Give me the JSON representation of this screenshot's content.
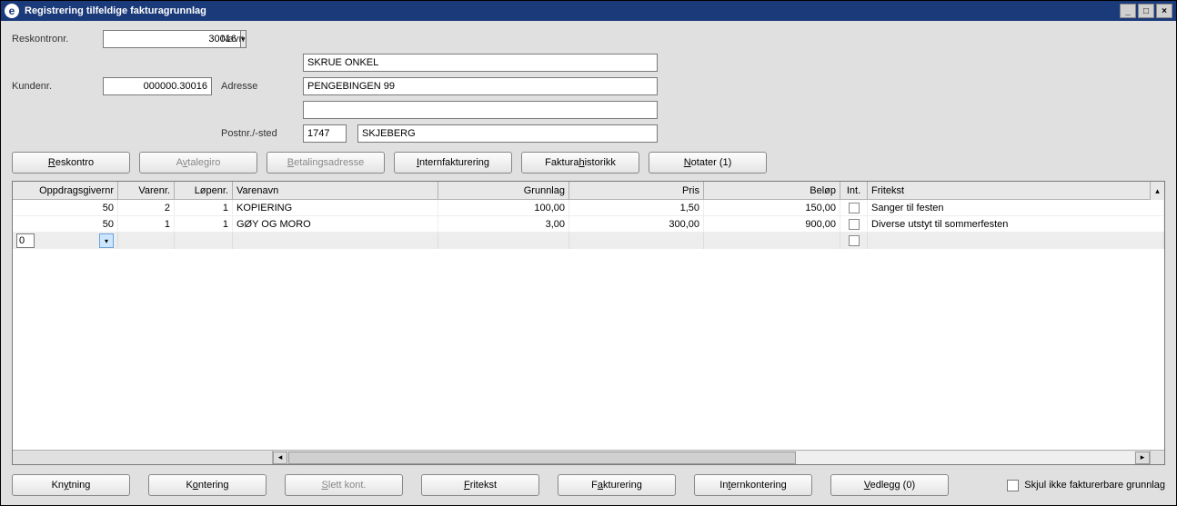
{
  "titlebar": {
    "icon_letter": "e",
    "title": "Registrering tilfeldige fakturagrunnlag"
  },
  "form": {
    "reskontronr_label": "Reskontronr.",
    "reskontronr_value": "30016",
    "kundenr_label": "Kundenr.",
    "kundenr_value": "000000.30016",
    "navn_label": "Navn",
    "navn_value": "SKRUE ONKEL",
    "adresse_label": "Adresse",
    "adresse_value": "PENGEBINGEN 99",
    "adresse2_value": "",
    "postnr_label": "Postnr./-sted",
    "postnr_value": "1747",
    "poststed_value": "SKJEBERG"
  },
  "top_buttons": {
    "reskontro": "Reskontro",
    "avtalegiro": "Avtalegiro",
    "betalingsadresse": "Betalingsadresse",
    "internfakturering": "Internfakturering",
    "fakturahistorikk": "Fakturahistorikk",
    "notater": "Notater (1)"
  },
  "grid": {
    "headers": {
      "oppdrag": "Oppdragsgivernr",
      "varenr": "Varenr.",
      "lopenr": "Løpenr.",
      "varenavn": "Varenavn",
      "grunnlag": "Grunnlag",
      "pris": "Pris",
      "belop": "Beløp",
      "int": "Int.",
      "fritekst": "Fritekst"
    },
    "rows": [
      {
        "oppdrag": "50",
        "varenr": "2",
        "lopenr": "1",
        "varenavn": "KOPIERING",
        "grunnlag": "100,00",
        "pris": "1,50",
        "belop": "150,00",
        "int": false,
        "fritekst": "Sanger til festen"
      },
      {
        "oppdrag": "50",
        "varenr": "1",
        "lopenr": "1",
        "varenavn": "GØY OG MORO",
        "grunnlag": "3,00",
        "pris": "300,00",
        "belop": "900,00",
        "int": false,
        "fritekst": "Diverse utstyt til sommerfesten"
      }
    ],
    "new_row_value": "0"
  },
  "bottom_buttons": {
    "knytning": "Knytning",
    "kontering": "Kontering",
    "slett_kont": "Slett kont.",
    "fritekst": "Fritekst",
    "fakturering": "Fakturering",
    "internkontering": "Internkontering",
    "vedlegg": "Vedlegg (0)"
  },
  "bottom_checkbox_label": "Skjul ikke fakturerbare grunnlag"
}
